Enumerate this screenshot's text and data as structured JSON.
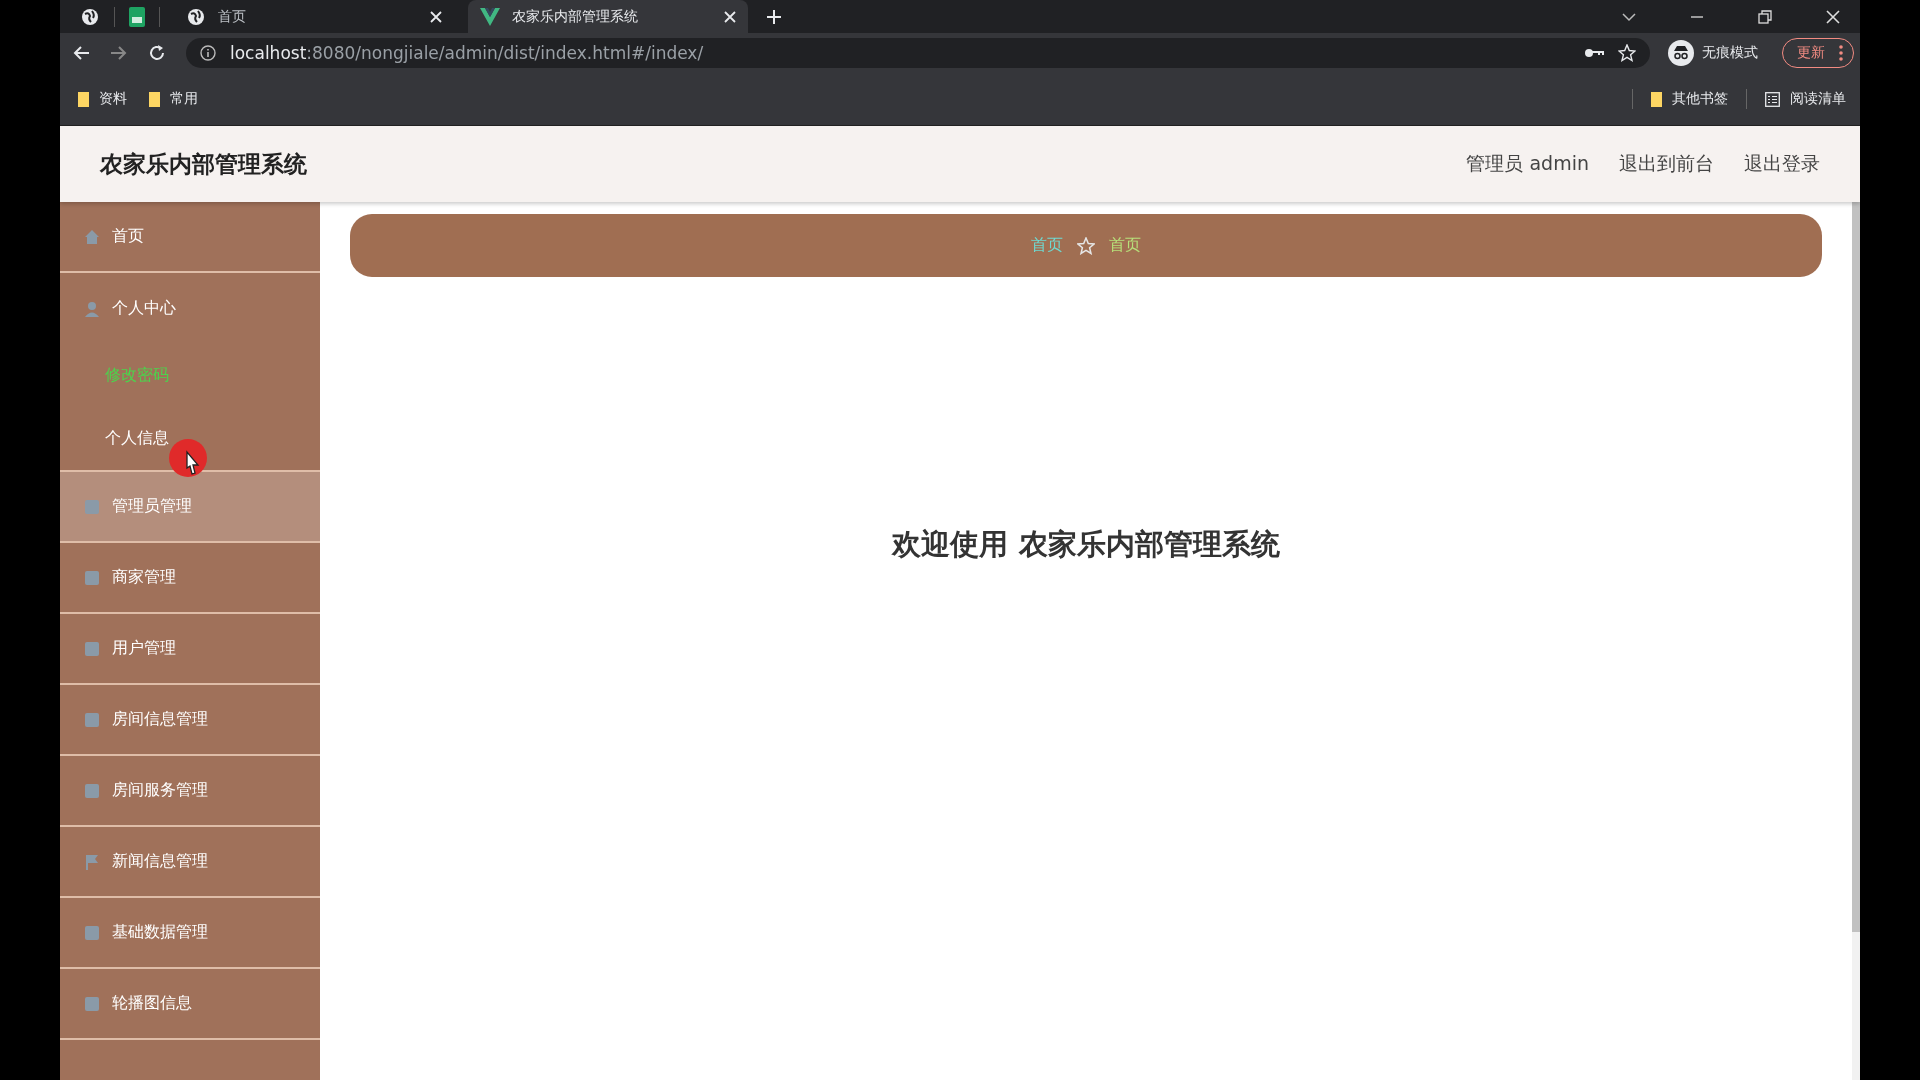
{
  "browser": {
    "tabs": [
      {
        "label": "首页",
        "selected": false
      },
      {
        "label": "农家乐内部管理系统",
        "selected": true
      }
    ],
    "url": {
      "host": "localhost",
      "path": ":8080/nongjiale/admin/dist/index.html#/index/"
    },
    "profile": "无痕模式",
    "update_button": "更新",
    "bookmarks": [
      {
        "label": "资料"
      },
      {
        "label": "常用"
      }
    ],
    "bookmarks_right": [
      "其他书签",
      "阅读清单"
    ]
  },
  "header": {
    "title": "农家乐内部管理系统",
    "links": [
      "管理员 admin",
      "退出到前台",
      "退出登录"
    ]
  },
  "sidebar": {
    "items": [
      {
        "label": "首页",
        "hovered": false
      },
      {
        "label": "个人中心",
        "hovered": false,
        "children": [
          {
            "label": "修改密码",
            "selected": true
          },
          {
            "label": "个人信息",
            "selected": false
          }
        ]
      },
      {
        "label": "管理员管理",
        "hovered": true
      },
      {
        "label": "商家管理",
        "hovered": false
      },
      {
        "label": "用户管理",
        "hovered": false
      },
      {
        "label": "房间信息管理",
        "hovered": false
      },
      {
        "label": "房间服务管理",
        "hovered": false
      },
      {
        "label": "新闻信息管理",
        "hovered": false
      },
      {
        "label": "基础数据管理",
        "hovered": false
      },
      {
        "label": "轮播图信息",
        "hovered": false
      }
    ]
  },
  "breadcrumb": [
    "首页",
    "首页"
  ],
  "welcome": "欢迎使用 农家乐内部管理系统"
}
